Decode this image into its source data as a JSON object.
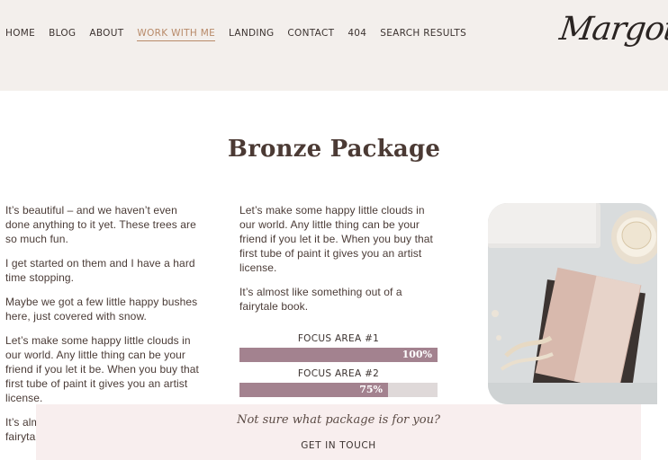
{
  "nav": {
    "items": [
      {
        "label": "HOME"
      },
      {
        "label": "BLOG"
      },
      {
        "label": "ABOUT"
      },
      {
        "label": "WORK WITH ME"
      },
      {
        "label": "LANDING"
      },
      {
        "label": "CONTACT"
      },
      {
        "label": "404"
      },
      {
        "label": "SEARCH RESULTS"
      }
    ],
    "active": "WORK WITH ME"
  },
  "logo": {
    "word": "Margot"
  },
  "page": {
    "title": "Bronze Package"
  },
  "left_column": {
    "paragraphs": [
      "It’s beautiful – and we haven’t even done anything to it yet. These trees are so much fun.",
      "I get started on them and I have a hard time stopping.",
      "Maybe we got a few little happy bushes here, just covered with snow.",
      "Let’s make some happy little clouds in our world. Any little thing can be your friend if you let it be. When you buy that first tube of paint it gives you an artist license.",
      "It’s almost like something out of a fairytale book."
    ]
  },
  "middle_column": {
    "paragraphs": [
      "Let’s make some happy little clouds in our world. Any little thing can be your friend if you let it be. When you buy that first tube of paint it gives you an artist license.",
      "It’s almost like something out of a fairytale book."
    ]
  },
  "focus_areas": [
    {
      "label": "FOCUS AREA #1",
      "percent_text": "100%",
      "value": 1.0
    },
    {
      "label": "FOCUS AREA #2",
      "percent_text": "75%",
      "value": 0.75
    }
  ],
  "banner": {
    "question": "Not sure what package is for you?",
    "cta": "GET IN TOUCH"
  },
  "colors": {
    "header_bg": "#f3efec",
    "accent": "#b88a69",
    "bar_fill": "#a3828f",
    "bar_track": "#dfd9d9",
    "banner_bg": "#f8eeee"
  }
}
